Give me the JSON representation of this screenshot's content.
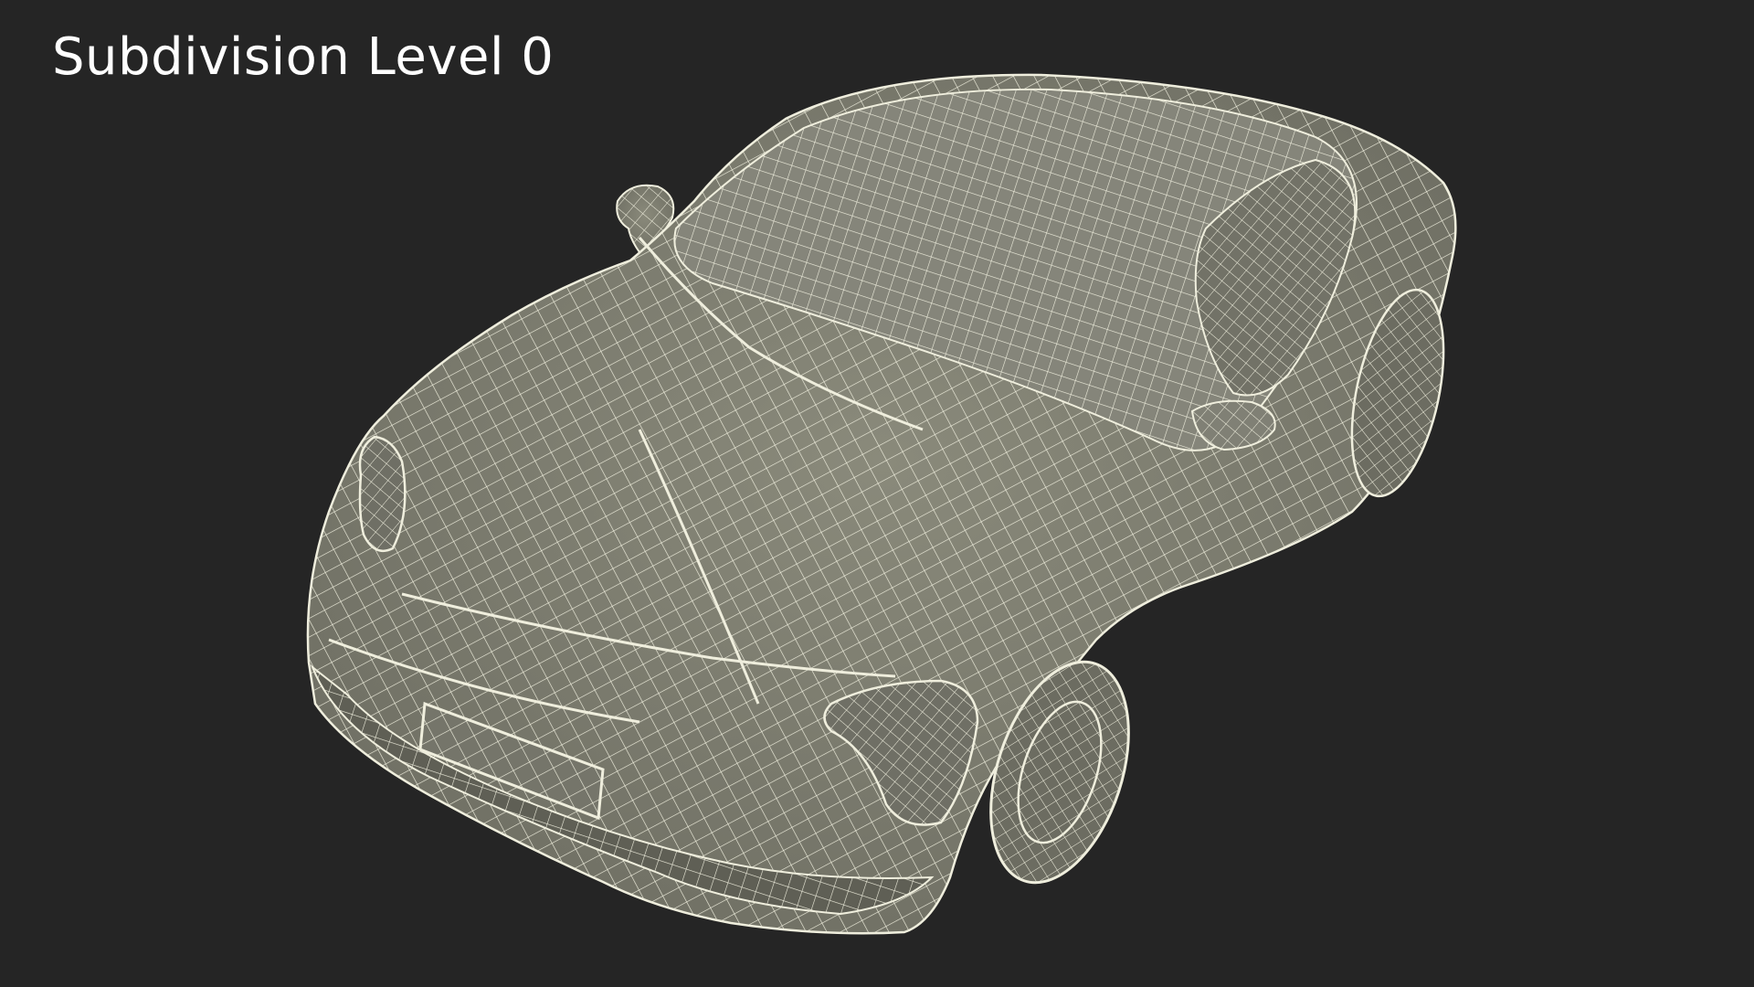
{
  "caption": "Subdivision Level 0",
  "colors": {
    "background": "#252525",
    "surface": "#7d7d6f",
    "surface_dark": "#5f5f55",
    "wire": "#efeedd",
    "caption": "#ffffff"
  },
  "subject": "car-wireframe-render"
}
